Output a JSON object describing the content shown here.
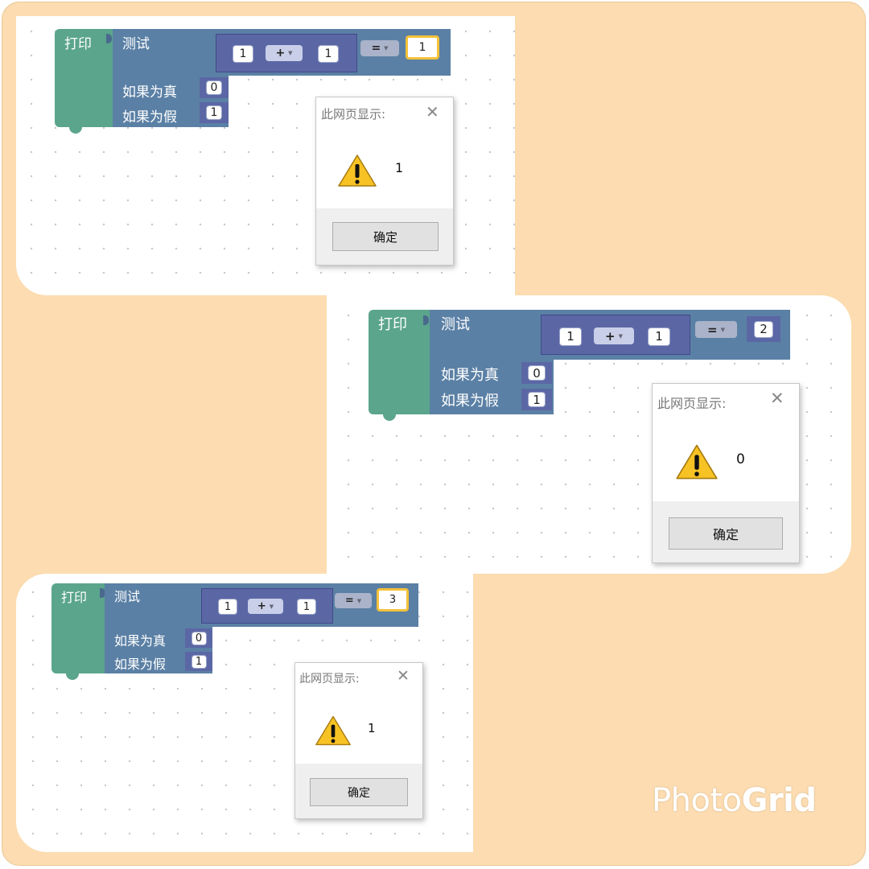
{
  "screenshots": [
    {
      "blocks": {
        "print_label": "打印",
        "test_label": "测试",
        "left_operand": "1",
        "arith_op": "+",
        "right_operand": "1",
        "compare_op": "=",
        "compare_value": "1",
        "if_true_label": "如果为真",
        "if_true_value": "0",
        "if_false_label": "如果为假",
        "if_false_value": "1"
      },
      "dialog": {
        "title": "此网页显示:",
        "message": "1",
        "ok_label": "确定"
      }
    },
    {
      "blocks": {
        "print_label": "打印",
        "test_label": "测试",
        "left_operand": "1",
        "arith_op": "+",
        "right_operand": "1",
        "compare_op": "=",
        "compare_value": "2",
        "if_true_label": "如果为真",
        "if_true_value": "0",
        "if_false_label": "如果为假",
        "if_false_value": "1"
      },
      "dialog": {
        "title": "此网页显示:",
        "message": "0",
        "ok_label": "确定"
      }
    },
    {
      "blocks": {
        "print_label": "打印",
        "test_label": "测试",
        "left_operand": "1",
        "arith_op": "+",
        "right_operand": "1",
        "compare_op": "=",
        "compare_value": "3",
        "if_true_label": "如果为真",
        "if_true_value": "0",
        "if_false_label": "如果为假",
        "if_false_value": "1"
      },
      "dialog": {
        "title": "此网页显示:",
        "message": "1",
        "ok_label": "确定"
      }
    }
  ],
  "icons": {
    "dropdown": "dropdown-triangle-icon",
    "close": "close-icon",
    "warning": "warning-icon"
  },
  "colors": {
    "background": "#fcdcb0",
    "print_block": "#5ba58c",
    "logic_block": "#5b80a5",
    "math_block": "#5b67a5",
    "selection": "#f3c13a"
  },
  "watermark": {
    "part1": "Photo",
    "part2": "Grid"
  }
}
